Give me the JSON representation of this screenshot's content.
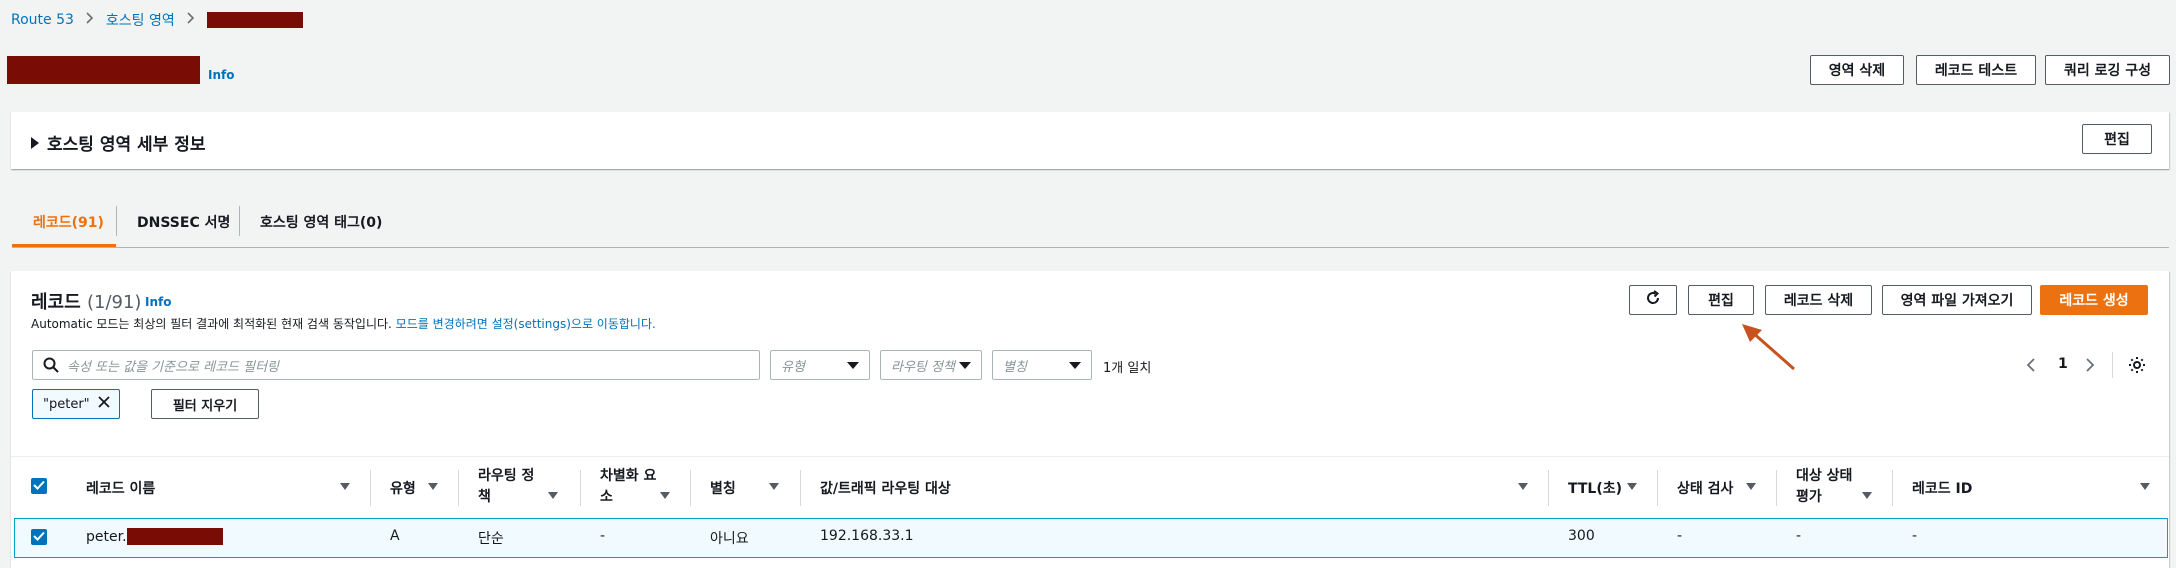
{
  "breadcrumb": {
    "item1": "Route 53",
    "item2": "호스팅 영역"
  },
  "header": {
    "info": "Info",
    "buttons": {
      "delete_zone": "영역 삭제",
      "test_record": "레코드 테스트",
      "query_logging": "쿼리 로깅 구성"
    }
  },
  "details_panel": {
    "title": "호스팅 영역 세부 정보",
    "edit": "편집"
  },
  "tabs": [
    "레코드(91)",
    "DNSSEC 서명",
    "호스팅 영역 태그(0)"
  ],
  "records": {
    "title": "레코드",
    "count": "(1/91)",
    "info": "Info",
    "desc_prefix": "Automatic 모드는 최상의 필터 결과에 최적화된 현재 검색 동작입니다. ",
    "desc_link": "모드를 변경하려면 설정(settings)으로 이동합니다.",
    "buttons": {
      "edit": "편집",
      "delete": "레코드 삭제",
      "import": "영역 파일 가져오기",
      "create": "레코드 생성"
    },
    "search_placeholder": "속성 또는 값을 기준으로 레코드 필터링",
    "filters": {
      "type": "유형",
      "routing": "라우팅 정책",
      "alias": "별칭"
    },
    "match_count": "1개 일치",
    "page": "1",
    "token": "\"peter\"",
    "clear_filters": "필터 지우기"
  },
  "table": {
    "headers": {
      "name": "레코드 이름",
      "type": "유형",
      "routing1": "라우팅 정",
      "routing2": "책",
      "diff1": "차별화 요",
      "diff2": "소",
      "alias": "별칭",
      "value": "값/트래픽 라우팅 대상",
      "ttl": "TTL(초)",
      "health": "상태 검사",
      "target1": "대상 상태",
      "target2": "평가",
      "record_id": "레코드 ID"
    },
    "row": {
      "name_prefix": "peter.",
      "type": "A",
      "routing": "단순",
      "diff": "-",
      "alias": "아니요",
      "value": "192.168.33.1",
      "ttl": "300",
      "health": "-",
      "target": "-",
      "record_id": "-"
    }
  },
  "colors": {
    "accent": "#ec7211",
    "link": "#0073bb",
    "redaction": "#7a0c06",
    "selected_row": "#f1faff"
  }
}
